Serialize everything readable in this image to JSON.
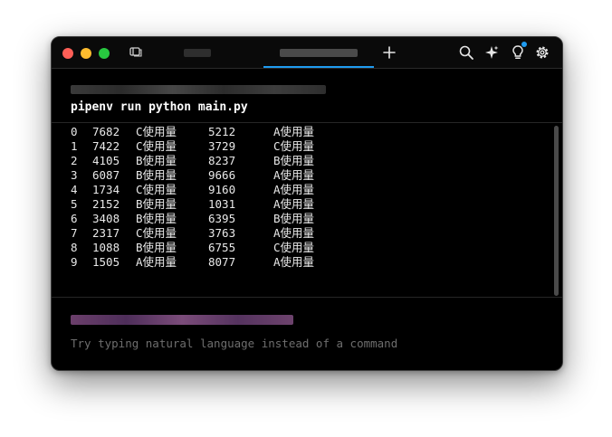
{
  "window": {
    "controls": [
      "close",
      "minimize",
      "zoom"
    ]
  },
  "tabs": [
    {
      "label": "",
      "active": false
    },
    {
      "label": "",
      "active": true
    }
  ],
  "toolbar": {
    "new_tab_icon": "plus-icon",
    "icons": [
      "search-icon",
      "sparkle-icon",
      "lightbulb-icon",
      "gear-icon"
    ],
    "accent": "#1f9bf0"
  },
  "block": {
    "command": "pipenv run python main.py",
    "rows": [
      {
        "idx": "0",
        "v1": "7682",
        "t1": "C使用量",
        "v2": "5212",
        "t2": "A使用量"
      },
      {
        "idx": "1",
        "v1": "7422",
        "t1": "C使用量",
        "v2": "3729",
        "t2": "C使用量"
      },
      {
        "idx": "2",
        "v1": "4105",
        "t1": "B使用量",
        "v2": "8237",
        "t2": "B使用量"
      },
      {
        "idx": "3",
        "v1": "6087",
        "t1": "B使用量",
        "v2": "9666",
        "t2": "A使用量"
      },
      {
        "idx": "4",
        "v1": "1734",
        "t1": "C使用量",
        "v2": "9160",
        "t2": "A使用量"
      },
      {
        "idx": "5",
        "v1": "2152",
        "t1": "B使用量",
        "v2": "1031",
        "t2": "A使用量"
      },
      {
        "idx": "6",
        "v1": "3408",
        "t1": "B使用量",
        "v2": "6395",
        "t2": "B使用量"
      },
      {
        "idx": "7",
        "v1": "2317",
        "t1": "C使用量",
        "v2": "3763",
        "t2": "A使用量"
      },
      {
        "idx": "8",
        "v1": "1088",
        "t1": "B使用量",
        "v2": "6755",
        "t2": "C使用量"
      },
      {
        "idx": "9",
        "v1": "1505",
        "t1": "A使用量",
        "v2": "8077",
        "t2": "A使用量"
      }
    ]
  },
  "input": {
    "placeholder": "Try typing natural language instead of a command"
  }
}
